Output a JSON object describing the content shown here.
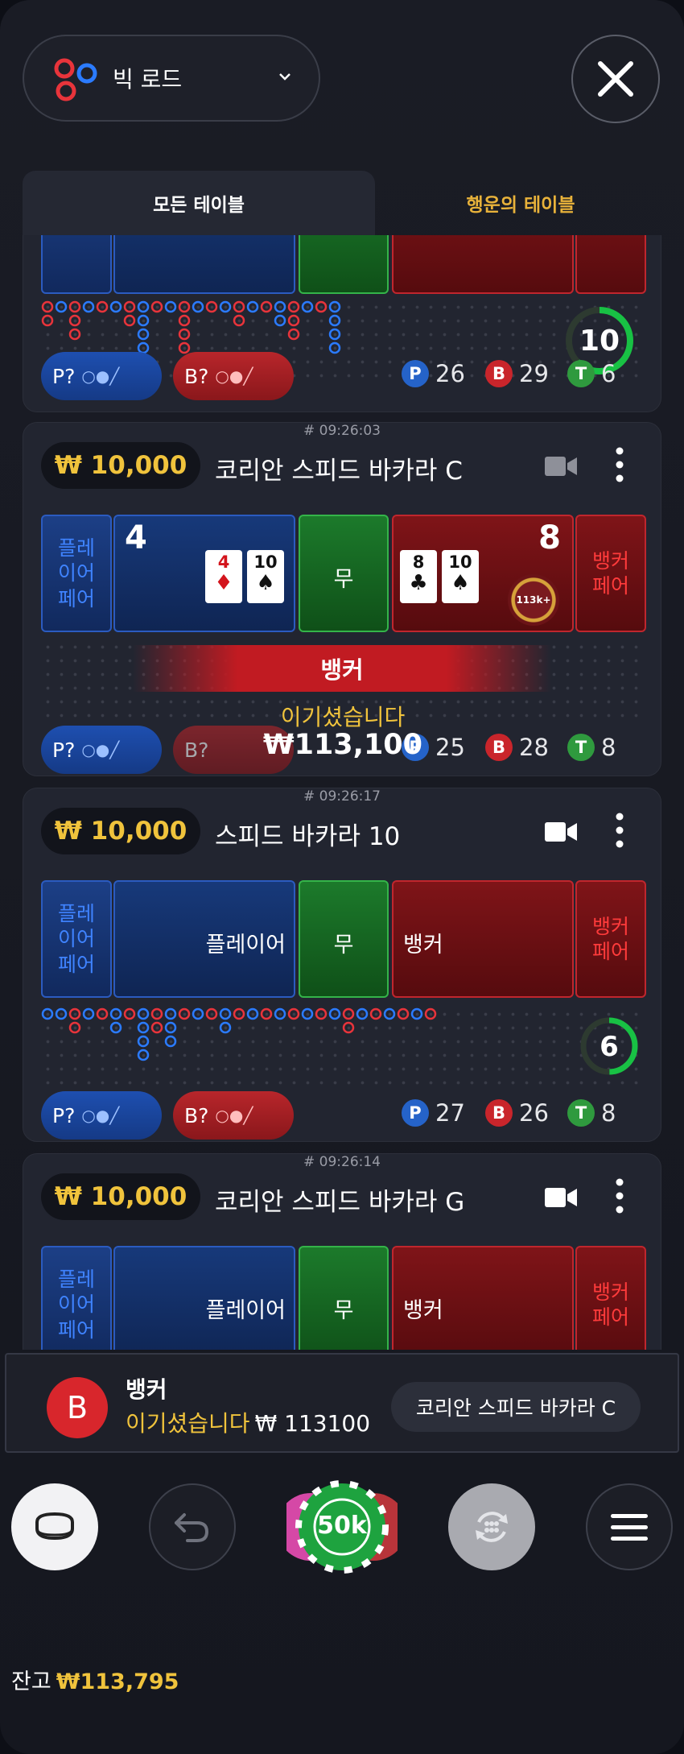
{
  "header": {
    "view_label": "빅 로드"
  },
  "tabs": {
    "all": "모든 테이블",
    "lucky": "행운의 테이블"
  },
  "labels": {
    "player_pair": "플레\n이어\n페어",
    "banker_pair": "뱅커\n페어",
    "player": "플레이어",
    "tie": "무",
    "banker": "뱅커",
    "p_side": "P?",
    "b_side": "B?"
  },
  "card0": {
    "countdown": "10",
    "stats": {
      "p": "26",
      "b": "29",
      "t": "6"
    }
  },
  "card1": {
    "time": "# 09:26:03",
    "bet": "₩ 10,000",
    "name": "코리안 스피드 바카라 C",
    "player_score": "4",
    "banker_score": "8",
    "player_cards": [
      {
        "rank": "4",
        "suit": "♦"
      },
      {
        "rank": "10",
        "suit": "♠"
      }
    ],
    "banker_cards": [
      {
        "rank": "8",
        "suit": "♣"
      },
      {
        "rank": "10",
        "suit": "♠"
      }
    ],
    "chip": "113k+",
    "winner": "뱅커",
    "win_msg": "이기셨습니다",
    "win_amount": "₩113,100",
    "stats": {
      "p": "25",
      "b": "28",
      "t": "8"
    }
  },
  "card2": {
    "time": "# 09:26:17",
    "bet": "₩ 10,000",
    "name": "스피드 바카라 10",
    "countdown": "6",
    "stats": {
      "p": "27",
      "b": "26",
      "t": "8"
    }
  },
  "card3": {
    "time": "# 09:26:14",
    "bet": "₩ 10,000",
    "name": "코리안 스피드 바카라 G"
  },
  "toast": {
    "badge": "B",
    "title": "뱅커",
    "win": "이기셨습니다",
    "amount": "₩ 113100",
    "table": "코리안 스피드 바카라 C"
  },
  "controls": {
    "chip_value": "50k"
  },
  "balance": {
    "label": "잔고",
    "value": "₩113,795"
  },
  "colors": {
    "gold": "#f0c33c",
    "player": "#2b5bc0",
    "banker": "#c0262d",
    "tie": "#34b449"
  }
}
